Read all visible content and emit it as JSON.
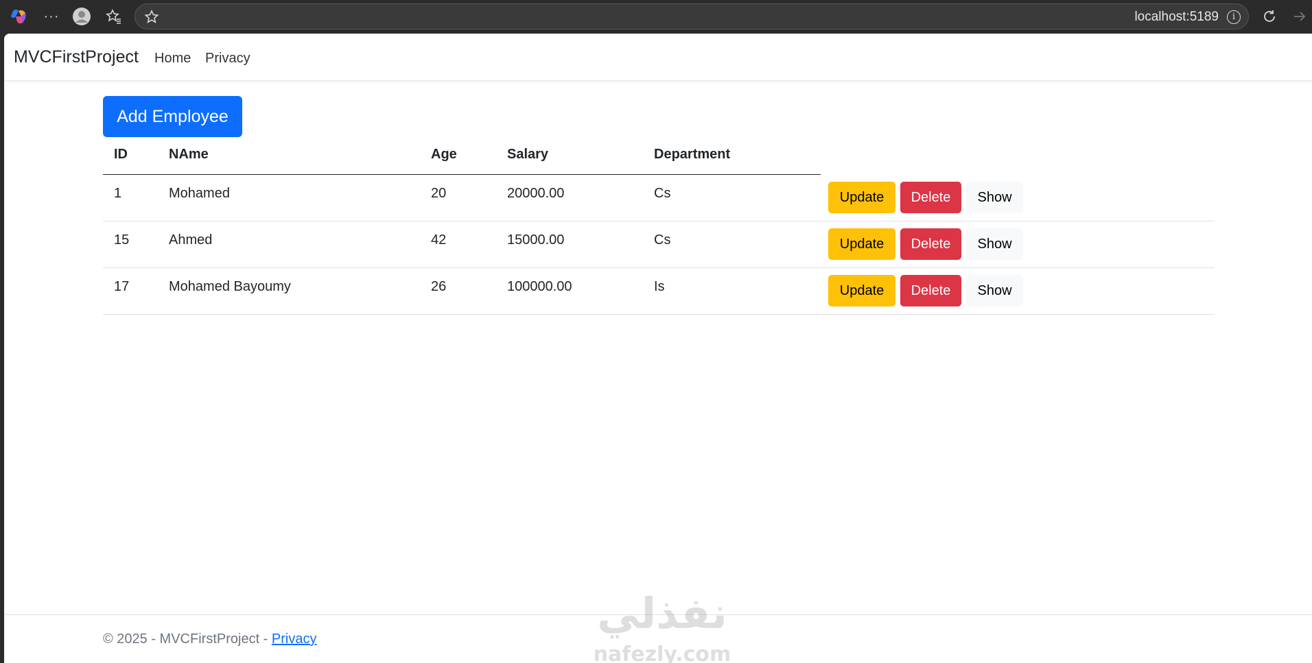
{
  "browser": {
    "url": "localhost:5189"
  },
  "navbar": {
    "brand": "MVCFirstProject",
    "links": [
      {
        "label": "Home"
      },
      {
        "label": "Privacy"
      }
    ]
  },
  "main": {
    "add_button_label": "Add Employee",
    "table": {
      "headers": [
        "ID",
        "NAme",
        "Age",
        "Salary",
        "Department"
      ],
      "rows": [
        {
          "id": "1",
          "name": "Mohamed",
          "age": "20",
          "salary": "20000.00",
          "department": "Cs"
        },
        {
          "id": "15",
          "name": "Ahmed",
          "age": "42",
          "salary": "15000.00",
          "department": "Cs"
        },
        {
          "id": "17",
          "name": "Mohamed Bayoumy",
          "age": "26",
          "salary": "100000.00",
          "department": "Is"
        }
      ],
      "actions": {
        "update": "Update",
        "delete": "Delete",
        "show": "Show"
      }
    }
  },
  "footer": {
    "text": "© 2025 - MVCFirstProject - ",
    "link": "Privacy"
  },
  "watermark": {
    "arabic": "نفذلي",
    "latin": "nafezly.com"
  }
}
